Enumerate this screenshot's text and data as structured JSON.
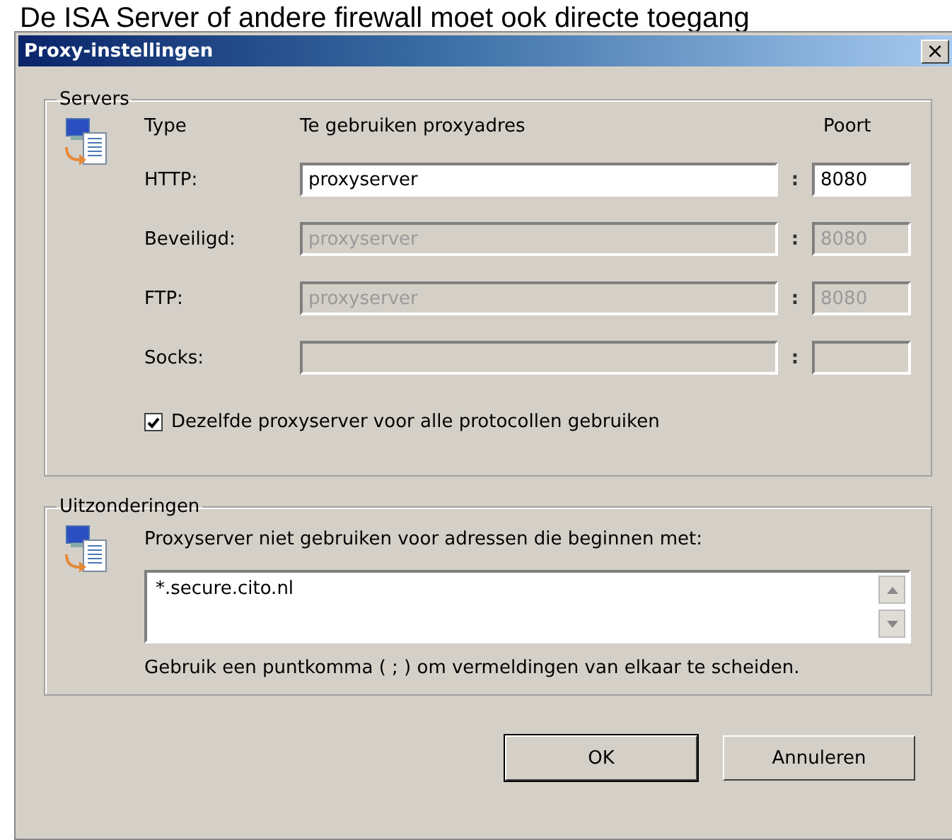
{
  "background_text": "De ISA Server of andere firewall moet ook directe toegang",
  "window": {
    "title": "Proxy-instellingen",
    "close": "×"
  },
  "servers": {
    "legend": "Servers",
    "header_type": "Type",
    "header_address": "Te gebruiken proxyadres",
    "header_port": "Poort",
    "rows": [
      {
        "label": "HTTP:",
        "address": "proxyserver",
        "separator": ":",
        "port": "8080",
        "disabled": false
      },
      {
        "label": "Beveiligd:",
        "address": "proxyserver",
        "separator": ":",
        "port": "8080",
        "disabled": true
      },
      {
        "label": "FTP:",
        "address": "proxyserver",
        "separator": ":",
        "port": "8080",
        "disabled": true
      },
      {
        "label": "Socks:",
        "separator": ":",
        "disabled": true
      }
    ],
    "same_proxy": {
      "label": "Dezelfde proxyserver voor alle protocollen gebruiken",
      "checked": true
    }
  },
  "exceptions": {
    "legend": "Uitzonderingen",
    "prompt": "Proxyserver niet gebruiken voor adressen die beginnen met:",
    "value": "*.secure.cito.nl",
    "hint": "Gebruik een puntkomma ( ; ) om vermeldingen van elkaar te scheiden."
  },
  "buttons": [
    {
      "label": "OK",
      "default": true
    },
    {
      "label": "Annuleren",
      "default": false
    }
  ]
}
